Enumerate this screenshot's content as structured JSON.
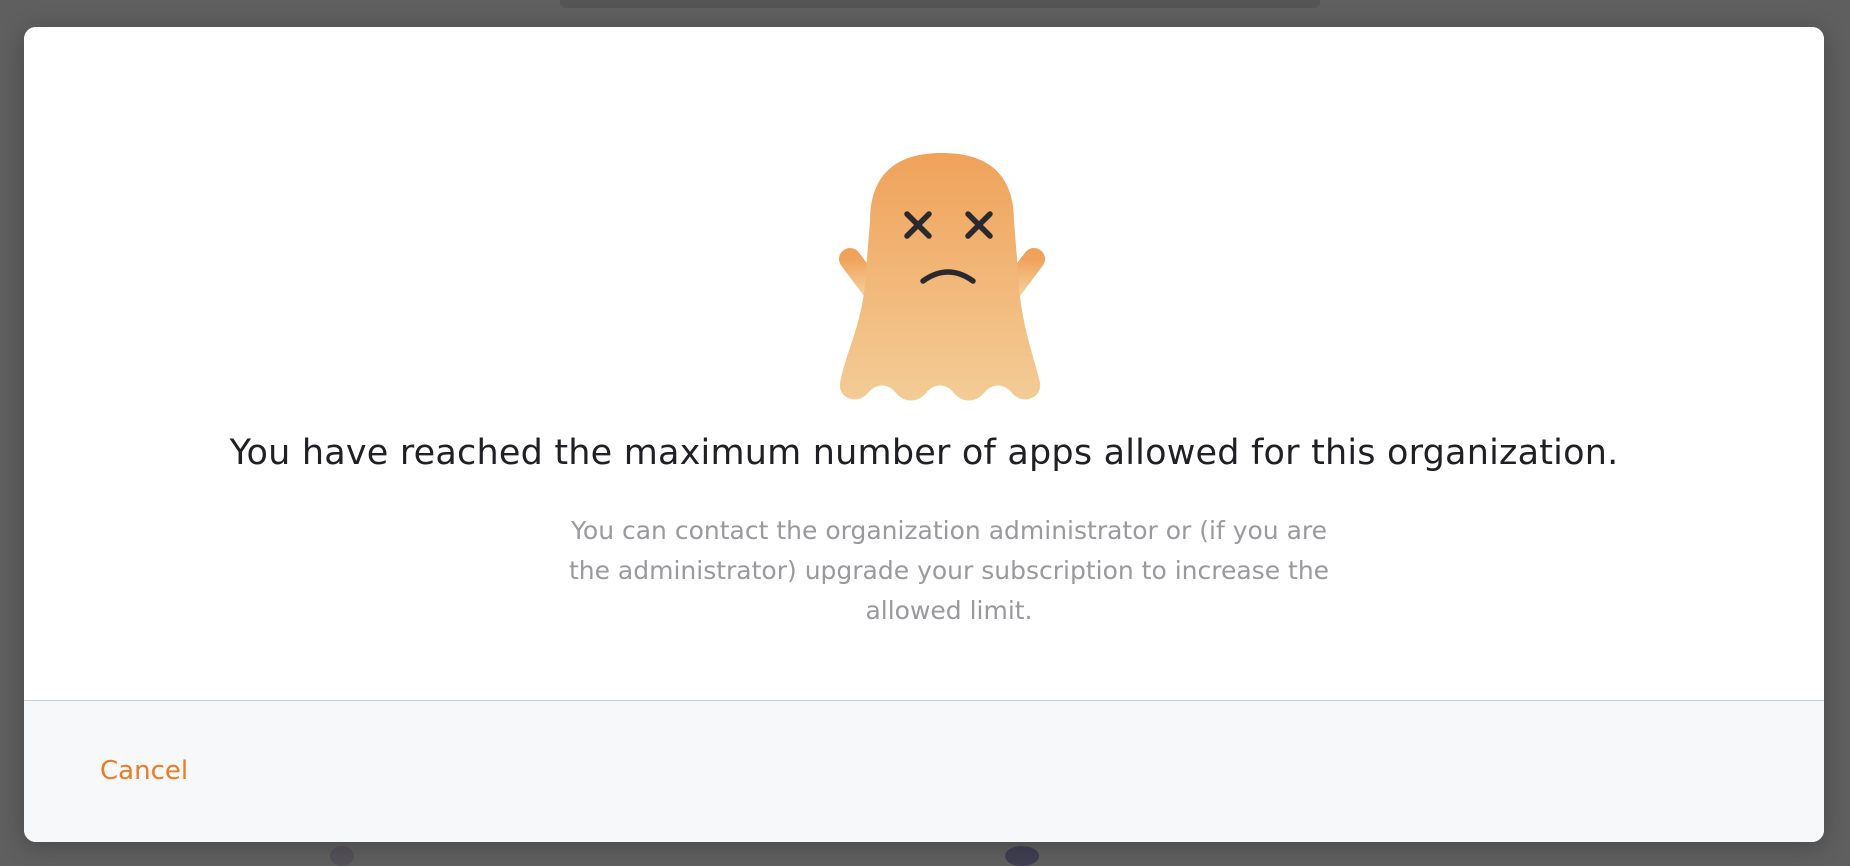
{
  "dialog": {
    "headline": "You have reached the maximum number of apps allowed for this organization.",
    "subtext": "You can contact the organization administrator or (if you are the administrator) upgrade your subscription to increase the allowed limit.",
    "illustration": "sad-ghost-icon",
    "cancel_label": "Cancel"
  },
  "colors": {
    "accent": "#ee7a22",
    "ghost_top": "#f0a25a",
    "ghost_bottom": "#f3cc96",
    "headline": "#1f1f24",
    "subtext": "#9a9a9e",
    "footer_bg": "#f7f8fa",
    "backdrop": "#5f5f5f"
  }
}
